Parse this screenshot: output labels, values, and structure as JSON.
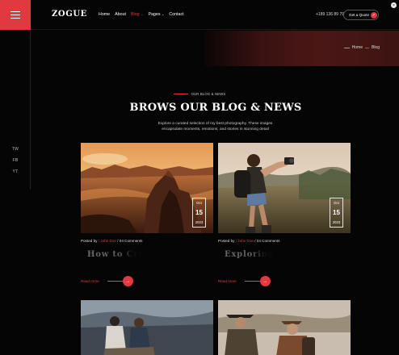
{
  "header": {
    "logo": "ZOGUE",
    "nav": [
      {
        "label": "Home",
        "active": false,
        "caret": ""
      },
      {
        "label": "About",
        "active": false,
        "caret": ""
      },
      {
        "label": "Blog",
        "active": true,
        "caret": "⌄"
      },
      {
        "label": "Pages",
        "active": false,
        "caret": "⌄"
      },
      {
        "label": "Contact",
        "active": false,
        "caret": ""
      }
    ],
    "phone": "+189 136 89 79",
    "quote_label": "Get a Quote",
    "quote_icon": "arrow-up-right-icon"
  },
  "sidebar": {
    "menu_icon": "hamburger-menu-icon",
    "socials": [
      "TW",
      "FB",
      "YT"
    ]
  },
  "breadcrumb": {
    "home": "Home",
    "current": "Blog"
  },
  "section": {
    "kicker": "OUR BLOG & NEWS",
    "title": "BROWS OUR BLOG & NEWS",
    "description": "Explore a curated selection of my best photography. These images encapsulate moments, emotions, and stories in stunning detail"
  },
  "posts": [
    {
      "month": "Oct",
      "day": "15",
      "year": "2023",
      "posted_by": "Posted by :",
      "author": "John Doe",
      "separator": "/",
      "comments": "04 Comments",
      "title": "How to Cre",
      "read_more": "Read more",
      "image": "desert-landscape"
    },
    {
      "month": "Oct",
      "day": "15",
      "year": "2023",
      "posted_by": "Posted by :",
      "author": "John Doe",
      "separator": "/",
      "comments": "04 Comments",
      "title": "Exploring",
      "read_more": "Read more",
      "image": "hiker-with-camera"
    }
  ],
  "colors": {
    "accent": "#e0393f",
    "background": "#050505"
  }
}
